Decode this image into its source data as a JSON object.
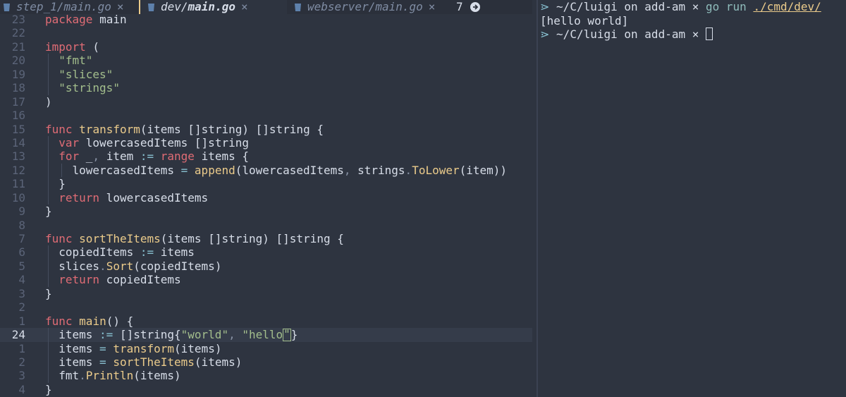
{
  "editor": {
    "tabs": [
      {
        "dir": "step_1/",
        "file": "main.go",
        "close": "×",
        "active": false
      },
      {
        "dir": "dev/",
        "file": "main.go",
        "close": "×",
        "active": true
      },
      {
        "dir": "webserver/",
        "file": "main.go",
        "close": "×",
        "active": false
      }
    ],
    "more_tabs_count": "7",
    "lines": [
      {
        "num": "23",
        "current": false
      },
      {
        "num": "22",
        "current": false
      },
      {
        "num": "21",
        "current": false
      },
      {
        "num": "20",
        "current": false
      },
      {
        "num": "19",
        "current": false
      },
      {
        "num": "18",
        "current": false
      },
      {
        "num": "17",
        "current": false
      },
      {
        "num": "16",
        "current": false
      },
      {
        "num": "15",
        "current": false
      },
      {
        "num": "14",
        "current": false
      },
      {
        "num": "13",
        "current": false
      },
      {
        "num": "12",
        "current": false
      },
      {
        "num": "11",
        "current": false
      },
      {
        "num": "10",
        "current": false
      },
      {
        "num": "9",
        "current": false
      },
      {
        "num": "8",
        "current": false
      },
      {
        "num": "7",
        "current": false
      },
      {
        "num": "6",
        "current": false
      },
      {
        "num": "5",
        "current": false
      },
      {
        "num": "4",
        "current": false
      },
      {
        "num": "3",
        "current": false
      },
      {
        "num": "2",
        "current": false
      },
      {
        "num": "1",
        "current": false
      },
      {
        "num": "24",
        "current": true
      },
      {
        "num": "1",
        "current": false
      },
      {
        "num": "2",
        "current": false
      },
      {
        "num": "3",
        "current": false
      },
      {
        "num": "4",
        "current": false
      }
    ],
    "code": [
      [
        [
          "kw",
          "package"
        ],
        [
          "pl",
          " main"
        ]
      ],
      [],
      [
        [
          "kw",
          "import"
        ],
        [
          "pl",
          " ("
        ]
      ],
      [
        [
          "str",
          "\"fmt\""
        ]
      ],
      [
        [
          "str",
          "\"slices\""
        ]
      ],
      [
        [
          "str",
          "\"strings\""
        ]
      ],
      [
        [
          "pl",
          ")"
        ]
      ],
      [],
      [
        [
          "kw",
          "func"
        ],
        [
          "pl",
          " "
        ],
        [
          "fn",
          "transform"
        ],
        [
          "pl",
          "(items []string) []string {"
        ]
      ],
      [
        [
          "kw",
          "var"
        ],
        [
          "pl",
          " lowercasedItems []string"
        ]
      ],
      [
        [
          "kw",
          "for"
        ],
        [
          "pl",
          " _"
        ],
        [
          "dim",
          ","
        ],
        [
          "pl",
          " item "
        ],
        [
          "op",
          ":="
        ],
        [
          "pl",
          " "
        ],
        [
          "kw",
          "range"
        ],
        [
          "pl",
          " items {"
        ]
      ],
      [
        [
          "pl",
          "lowercasedItems "
        ],
        [
          "op",
          "="
        ],
        [
          "pl",
          " "
        ],
        [
          "fn",
          "append"
        ],
        [
          "pl",
          "(lowercasedItems"
        ],
        [
          "dim",
          ","
        ],
        [
          "pl",
          " strings"
        ],
        [
          "dim",
          "."
        ],
        [
          "mt",
          "ToLower"
        ],
        [
          "pl",
          "(item))"
        ]
      ],
      [
        [
          "pl",
          "}"
        ]
      ],
      [
        [
          "kw",
          "return"
        ],
        [
          "pl",
          " lowercasedItems"
        ]
      ],
      [
        [
          "pl",
          "}"
        ]
      ],
      [],
      [
        [
          "kw",
          "func"
        ],
        [
          "pl",
          " "
        ],
        [
          "fn",
          "sortTheItems"
        ],
        [
          "pl",
          "(items []string) []string {"
        ]
      ],
      [
        [
          "pl",
          "copiedItems "
        ],
        [
          "op",
          ":="
        ],
        [
          "pl",
          " items"
        ]
      ],
      [
        [
          "pl",
          "slices"
        ],
        [
          "dim",
          "."
        ],
        [
          "mt",
          "Sort"
        ],
        [
          "pl",
          "(copiedItems)"
        ]
      ],
      [
        [
          "kw",
          "return"
        ],
        [
          "pl",
          " copiedItems"
        ]
      ],
      [
        [
          "pl",
          "}"
        ]
      ],
      [],
      [
        [
          "kw",
          "func"
        ],
        [
          "pl",
          " "
        ],
        [
          "fn",
          "main"
        ],
        [
          "pl",
          "() {"
        ]
      ],
      [
        [
          "pl",
          "items "
        ],
        [
          "op",
          ":="
        ],
        [
          "pl",
          " []string{"
        ],
        [
          "str",
          "\"world\""
        ],
        [
          "dim",
          ","
        ],
        [
          "pl",
          " "
        ],
        [
          "str",
          "\"hello"
        ],
        [
          "cursor",
          "\""
        ],
        [
          "pl",
          "}"
        ]
      ],
      [
        [
          "pl",
          "items "
        ],
        [
          "op",
          "="
        ],
        [
          "pl",
          " "
        ],
        [
          "fn",
          "transform"
        ],
        [
          "pl",
          "(items)"
        ]
      ],
      [
        [
          "pl",
          "items "
        ],
        [
          "op",
          "="
        ],
        [
          "pl",
          " "
        ],
        [
          "fn",
          "sortTheItems"
        ],
        [
          "pl",
          "(items)"
        ]
      ],
      [
        [
          "pl",
          "fmt"
        ],
        [
          "dim",
          "."
        ],
        [
          "mt",
          "Println"
        ],
        [
          "pl",
          "(items)"
        ]
      ],
      [
        [
          "pl",
          "}"
        ]
      ]
    ],
    "indent": [
      0,
      0,
      0,
      1,
      1,
      1,
      0,
      0,
      0,
      1,
      1,
      2,
      1,
      1,
      0,
      0,
      0,
      1,
      1,
      1,
      0,
      0,
      0,
      1,
      1,
      1,
      1,
      0
    ]
  },
  "terminal": {
    "prompt_icon": "⋗",
    "line1": {
      "path": "~/C/luigi",
      "on": "on",
      "branch": "add-am",
      "mark": "×",
      "cmd": "go run",
      "arg": "./cmd/dev/"
    },
    "output": "[hello world]",
    "line3": {
      "path": "~/C/luigi",
      "on": "on",
      "branch": "add-am",
      "mark": "×"
    }
  },
  "colors": {
    "background": "#2e3440",
    "keyword": "#e06c75",
    "function": "#ebcb8b",
    "string": "#a3be8c",
    "terminal_cmd": "#8fbcbb"
  }
}
